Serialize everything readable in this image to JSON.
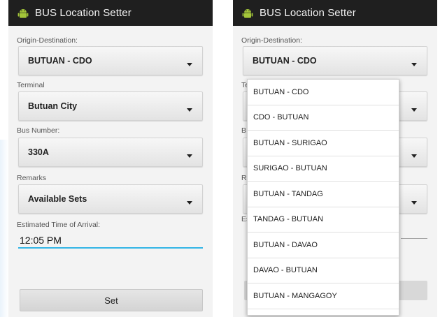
{
  "app": {
    "title": "BUS Location Setter",
    "icon": "android-icon"
  },
  "form": {
    "origin_label": "Origin-Destination:",
    "origin_value": "BUTUAN - CDO",
    "terminal_label": "Terminal",
    "terminal_value": "Butuan City",
    "bus_number_label": "Bus Number:",
    "bus_number_value": "330A",
    "remarks_label": "Remarks",
    "remarks_value": "Available Sets",
    "eta_label": "Estimated Time of Arrival:",
    "eta_value": "12:05 PM",
    "set_label": "Set"
  },
  "dropdown": {
    "items": [
      "BUTUAN - CDO",
      "CDO - BUTUAN",
      "BUTUAN - SURIGAO",
      "SURIGAO - BUTUAN",
      "BUTUAN - TANDAG",
      "TANDAG - BUTUAN",
      "BUTUAN - DAVAO",
      "DAVAO - BUTUAN",
      "BUTUAN - MANGAGOY"
    ]
  },
  "partial_labels": {
    "terminal": "Te",
    "bus": "B",
    "remarks": "R",
    "eta": "Es"
  },
  "colors": {
    "titlebar": "#1f1f1f",
    "accent": "#33b5e5",
    "android_green": "#a4c639"
  }
}
